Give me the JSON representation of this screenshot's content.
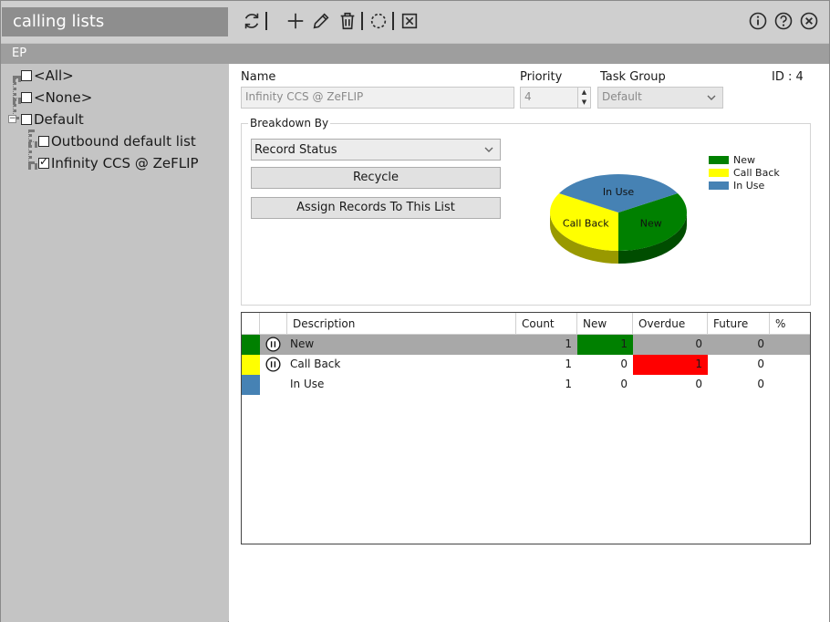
{
  "window": {
    "title": "calling lists",
    "subheader": "EP"
  },
  "toolbar": {
    "icons": [
      "refresh-icon",
      "add-icon",
      "edit-icon",
      "delete-icon",
      "loading-circle-icon",
      "close-box-icon"
    ],
    "right_icons": [
      "info-icon",
      "help-icon",
      "close-icon"
    ]
  },
  "tree": {
    "items": [
      {
        "label": "<All>",
        "checked": false
      },
      {
        "label": "<None>",
        "checked": false
      },
      {
        "label": "Default",
        "checked": false
      },
      {
        "label": "Outbound default list",
        "checked": false
      },
      {
        "label": "Infinity CCS @ ZeFLIP",
        "checked": true
      }
    ]
  },
  "form": {
    "name_label": "Name",
    "name_value": "Infinity CCS @ ZeFLIP",
    "priority_label": "Priority",
    "priority_value": "4",
    "task_group_label": "Task Group",
    "task_group_value": "Default",
    "id_text": "ID : 4"
  },
  "breakdown": {
    "title": "Breakdown By",
    "selected": "Record Status",
    "recycle_label": "Recycle",
    "assign_label": "Assign Records To This List"
  },
  "chart_data": {
    "type": "pie",
    "categories": [
      "New",
      "Call Back",
      "In Use"
    ],
    "values": [
      1,
      1,
      1
    ],
    "colors": [
      "#008000",
      "#ffff00",
      "#4682b4"
    ],
    "legend": [
      "New",
      "Call Back",
      "In Use"
    ],
    "legend_position": "right"
  },
  "table": {
    "headers": [
      "Description",
      "Count",
      "New",
      "Overdue",
      "Future",
      "%"
    ],
    "rows": [
      {
        "color": "#008000",
        "pause_icon": true,
        "description": "New",
        "count": "1",
        "new": "1",
        "overdue": "0",
        "future": "0",
        "percent": "",
        "selected": true
      },
      {
        "color": "#ffff00",
        "pause_icon": true,
        "description": "Call Back",
        "count": "1",
        "new": "0",
        "overdue": "1",
        "future": "0",
        "percent": "",
        "selected": false
      },
      {
        "color": "#4682b4",
        "pause_icon": false,
        "description": "In Use",
        "count": "1",
        "new": "0",
        "overdue": "0",
        "future": "0",
        "percent": "",
        "selected": false
      }
    ],
    "highlight_colors": {
      "new": "#008000",
      "overdue": "#ff0000",
      "selected_row": "#a8a8a8"
    }
  }
}
